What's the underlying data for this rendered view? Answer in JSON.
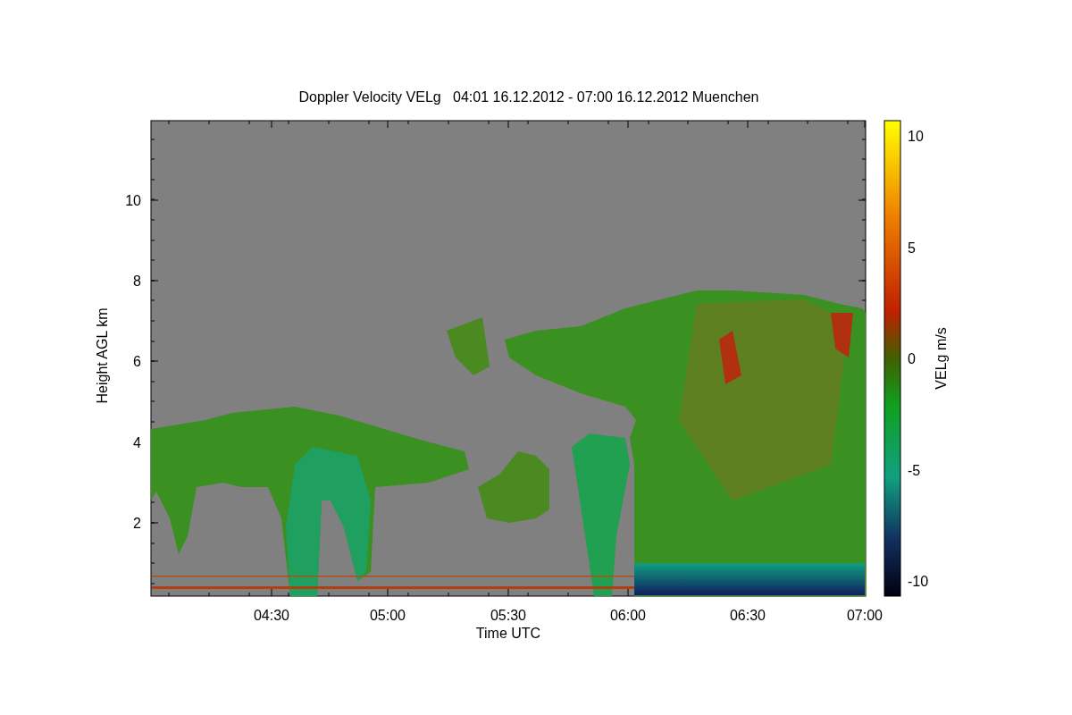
{
  "title": "Doppler Velocity VELg   04:01 16.12.2012 - 07:00 16.12.2012 Muenchen",
  "plot": {
    "xlabel": "Time UTC",
    "ylabel": "Height AGL km",
    "xticks": [
      "04:30",
      "05:00",
      "05:30",
      "06:00",
      "06:30",
      "07:00"
    ],
    "yticks": [
      "10",
      "8",
      "6",
      "4",
      "2"
    ]
  },
  "colorbar": {
    "label": "VELg m/s",
    "ticks": [
      "10",
      "5",
      "0",
      "-5",
      "-10"
    ]
  }
}
